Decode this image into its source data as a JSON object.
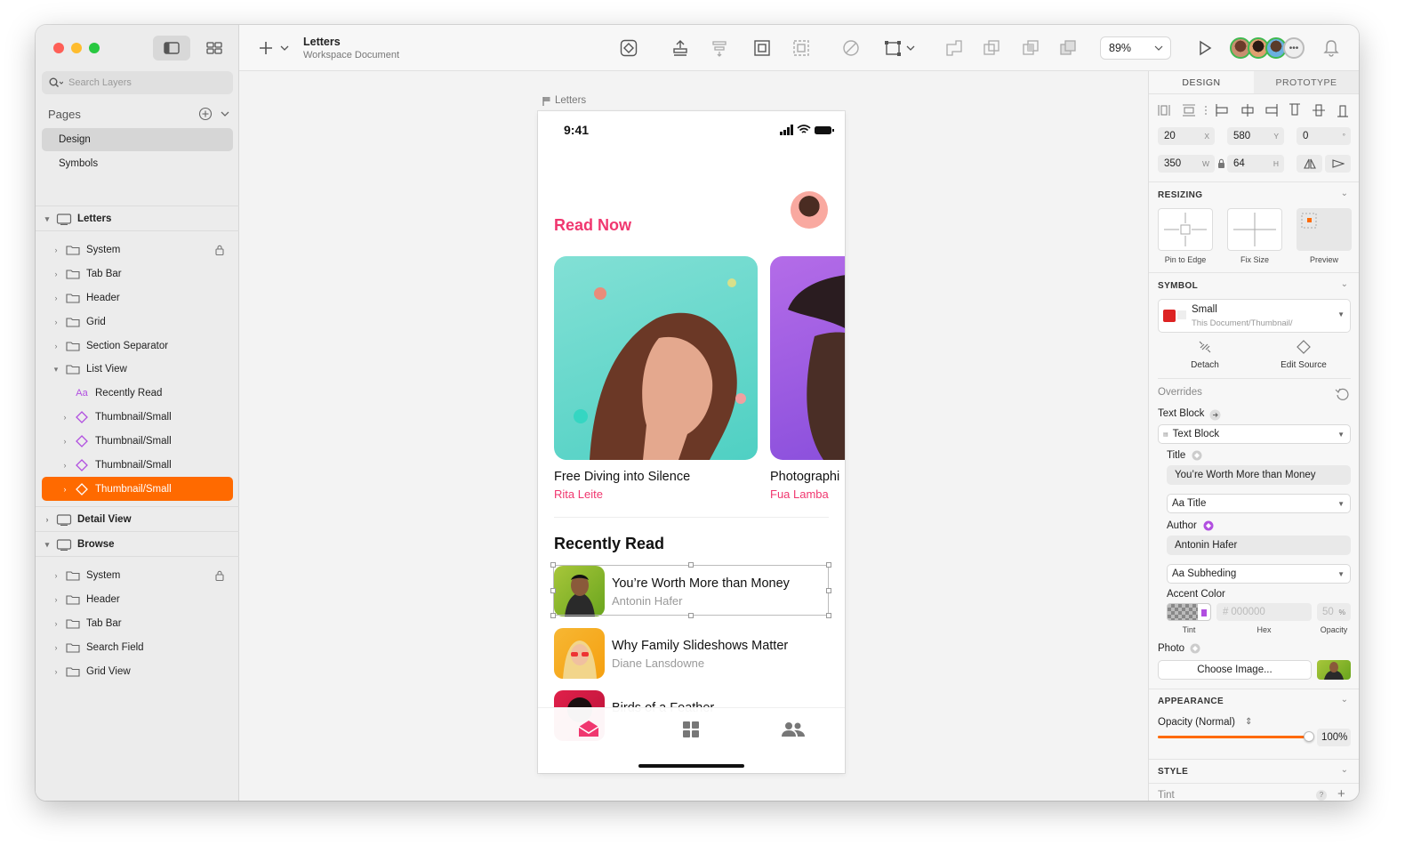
{
  "sidebar": {
    "search_placeholder": "Search Layers",
    "pages_label": "Pages",
    "pages": [
      "Design",
      "Symbols"
    ],
    "letters_artboard": "Letters",
    "letters_layers": [
      "System",
      "Tab Bar",
      "Header",
      "Grid",
      "Section Separator",
      "List View"
    ],
    "listview_children": [
      "Recently Read",
      "Thumbnail/Small",
      "Thumbnail/Small",
      "Thumbnail/Small",
      "Thumbnail/Small"
    ],
    "detail_artboard": "Detail View",
    "browse_artboard": "Browse",
    "browse_layers": [
      "System",
      "Header",
      "Tab Bar",
      "Search Field",
      "Grid View"
    ]
  },
  "toolbar": {
    "doc_title": "Letters",
    "doc_subtitle": "Workspace Document",
    "zoom": "89%"
  },
  "canvas": {
    "artboard_label": "Letters",
    "status_time": "9:41",
    "read_now": "Read Now",
    "cards": [
      {
        "title": "Free Diving into Silence",
        "author": "Rita Leite"
      },
      {
        "title": "Photographi",
        "author": "Fua Lamba"
      }
    ],
    "recently_read": "Recently Read",
    "rows": [
      {
        "title": "You’re Worth More than Money",
        "author": "Antonin Hafer"
      },
      {
        "title": "Why Family Slideshows Matter",
        "author": "Diane Lansdowne"
      },
      {
        "title": "Birds of a Feather",
        "author": ""
      }
    ]
  },
  "inspector": {
    "tab_design": "DESIGN",
    "tab_prototype": "PROTOTYPE",
    "x": "20",
    "x_suffix": "X",
    "y": "580",
    "y_suffix": "Y",
    "rotation": "0",
    "rotation_suffix": "°",
    "w": "350",
    "w_suffix": "W",
    "h": "64",
    "h_suffix": "H",
    "resizing_title": "RESIZING",
    "resize_labels": [
      "Pin to Edge",
      "Fix Size",
      "Preview"
    ],
    "symbol_title": "SYMBOL",
    "symbol_name": "Small",
    "symbol_path": "This Document/Thumbnail/",
    "detach": "Detach",
    "edit_source": "Edit Source",
    "overrides": "Overrides",
    "text_block_label": "Text Block",
    "text_block_value": "Text Block",
    "title_label": "Title",
    "title_value": "You’re Worth More than Money",
    "title_style": "Aa Title",
    "author_label": "Author",
    "author_value": "Antonin Hafer",
    "author_style": "Aa Subheding",
    "accent_label": "Accent Color",
    "hex_placeholder": "000000",
    "hex_prefix": "#",
    "opacity_value": "50",
    "opacity_suffix": "%",
    "accent_sub": [
      "Tint",
      "Hex",
      "Opacity"
    ],
    "photo_label": "Photo",
    "choose_image": "Choose Image...",
    "appearance_title": "APPEARANCE",
    "opacity_label": "Opacity (Normal)",
    "opacity_percent": "100%",
    "opacity_fraction": 1.0,
    "style_title": "STYLE",
    "tint_label": "Tint"
  },
  "colors": {
    "accent_pink": "#f0376f",
    "selection_orange": "#ff6a00",
    "symbol_purple": "#b14fe0"
  }
}
